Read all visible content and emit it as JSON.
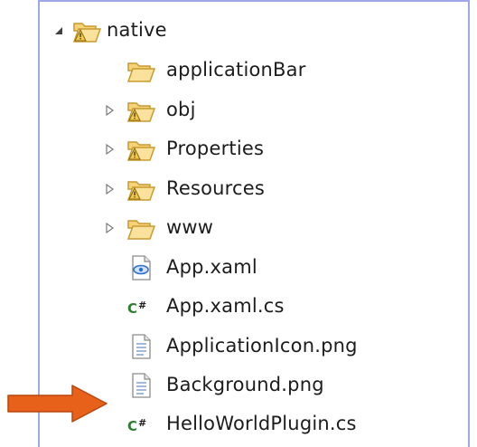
{
  "tree": {
    "root": {
      "label": "native",
      "expanded": true,
      "icon": "folder-open-warning-icon"
    },
    "items": [
      {
        "label": "applicationBar",
        "icon": "folder-open-icon",
        "expandable": false
      },
      {
        "label": "obj",
        "icon": "folder-open-warning-icon",
        "expandable": true
      },
      {
        "label": "Properties",
        "icon": "folder-open-warning-icon",
        "expandable": true
      },
      {
        "label": "Resources",
        "icon": "folder-open-warning-icon",
        "expandable": true
      },
      {
        "label": "www",
        "icon": "folder-open-icon",
        "expandable": true
      },
      {
        "label": "App.xaml",
        "icon": "xaml-file-icon",
        "expandable": false
      },
      {
        "label": "App.xaml.cs",
        "icon": "csharp-file-icon",
        "expandable": false
      },
      {
        "label": "ApplicationIcon.png",
        "icon": "document-file-icon",
        "expandable": false
      },
      {
        "label": "Background.png",
        "icon": "document-file-icon",
        "expandable": false
      },
      {
        "label": "HelloWorldPlugin.cs",
        "icon": "csharp-file-icon",
        "expandable": false
      }
    ]
  },
  "annotation": {
    "icon": "arrow-right-icon",
    "color": "#e8611a"
  },
  "colors": {
    "panel_border": "#9fa7e8",
    "folder_fill": "#f6d27a",
    "folder_stroke": "#c99a2e",
    "csharp_text": "#2e7d32"
  }
}
